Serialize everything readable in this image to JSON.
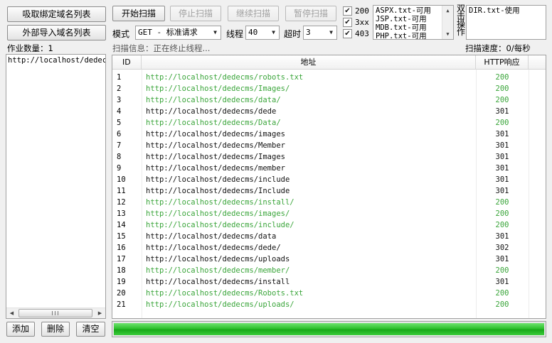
{
  "toolbar": {
    "fetch_bound_domains": "吸取绑定域名列表",
    "import_domains": "外部导入域名列表",
    "start_scan": "开始扫描",
    "stop_scan": "停止扫描",
    "continue_scan": "继续扫描",
    "pause_scan": "暂停扫描"
  },
  "options": {
    "mode_label": "模式",
    "mode_value": "GET - 标准请求",
    "threads_label": "线程",
    "threads_value": "40",
    "timeout_label": "超时",
    "timeout_value": "3"
  },
  "status_filters": [
    {
      "label": "200",
      "checked": true
    },
    {
      "label": "3xx",
      "checked": true
    },
    {
      "label": "403",
      "checked": true
    }
  ],
  "dictionaries": [
    "ASPX.txt-可用",
    "JSP.txt-可用",
    "MDB.txt-可用",
    "PHP.txt-可用"
  ],
  "dbl_click_hint": [
    "双",
    "击",
    "操",
    "作"
  ],
  "dir_dictionaries": [
    "DIR.txt-使用"
  ],
  "jobs": {
    "count_label": "作业数量：1",
    "items": [
      "http://localhost/dedecm"
    ],
    "add": "添加",
    "delete": "删除",
    "clear": "清空"
  },
  "scan_info": "扫描信息：正在终止线程...",
  "scan_speed": "扫描速度：0/每秒",
  "table": {
    "headers": {
      "id": "ID",
      "address": "地址",
      "http": "HTTP响应"
    },
    "rows": [
      {
        "id": "1",
        "url": "http://localhost/dedecms/robots.txt",
        "code": "200"
      },
      {
        "id": "2",
        "url": "http://localhost/dedecms/Images/",
        "code": "200"
      },
      {
        "id": "3",
        "url": "http://localhost/dedecms/data/",
        "code": "200"
      },
      {
        "id": "4",
        "url": "http://localhost/dedecms/dede",
        "code": "301"
      },
      {
        "id": "5",
        "url": "http://localhost/dedecms/Data/",
        "code": "200"
      },
      {
        "id": "6",
        "url": "http://localhost/dedecms/images",
        "code": "301"
      },
      {
        "id": "7",
        "url": "http://localhost/dedecms/Member",
        "code": "301"
      },
      {
        "id": "8",
        "url": "http://localhost/dedecms/Images",
        "code": "301"
      },
      {
        "id": "9",
        "url": "http://localhost/dedecms/member",
        "code": "301"
      },
      {
        "id": "10",
        "url": "http://localhost/dedecms/include",
        "code": "301"
      },
      {
        "id": "11",
        "url": "http://localhost/dedecms/Include",
        "code": "301"
      },
      {
        "id": "12",
        "url": "http://localhost/dedecms/install/",
        "code": "200"
      },
      {
        "id": "13",
        "url": "http://localhost/dedecms/images/",
        "code": "200"
      },
      {
        "id": "14",
        "url": "http://localhost/dedecms/include/",
        "code": "200"
      },
      {
        "id": "15",
        "url": "http://localhost/dedecms/data",
        "code": "301"
      },
      {
        "id": "16",
        "url": "http://localhost/dedecms/dede/",
        "code": "302"
      },
      {
        "id": "17",
        "url": "http://localhost/dedecms/uploads",
        "code": "301"
      },
      {
        "id": "18",
        "url": "http://localhost/dedecms/member/",
        "code": "200"
      },
      {
        "id": "19",
        "url": "http://localhost/dedecms/install",
        "code": "301"
      },
      {
        "id": "20",
        "url": "http://localhost/dedecms/Robots.txt",
        "code": "200"
      },
      {
        "id": "21",
        "url": "http://localhost/dedecms/uploads/",
        "code": "200"
      }
    ]
  },
  "progress": {
    "value": 1.0,
    "color": "#22b422"
  },
  "colors": {
    "status_200": "#3aa53a",
    "status_3xx": "#111111"
  }
}
